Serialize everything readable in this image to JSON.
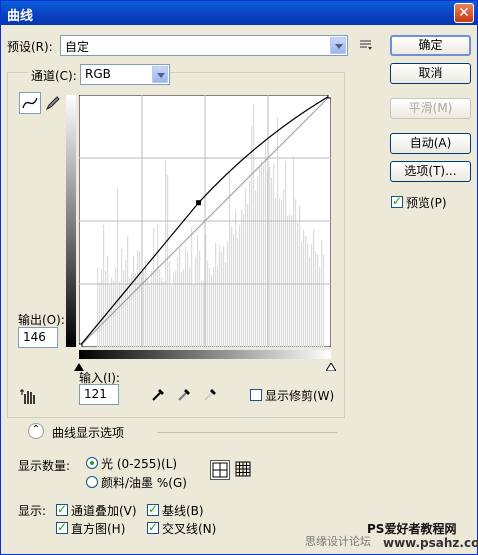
{
  "window": {
    "title": "曲线",
    "close_label": "✕"
  },
  "preset": {
    "label": "预设(R):",
    "value": "自定"
  },
  "buttons": {
    "ok": "确定",
    "cancel": "取消",
    "smooth": "平滑(M)",
    "auto": "自动(A)",
    "options": "选项(T)..."
  },
  "preview": {
    "label": "预览(P)",
    "checked": true
  },
  "channel": {
    "label": "通道(C):",
    "value": "RGB"
  },
  "output": {
    "label": "输出(O):",
    "value": "146"
  },
  "input": {
    "label": "输入(I):",
    "value": "121"
  },
  "show_clipping": {
    "label": "显示修剪(W)",
    "checked": false
  },
  "display_options": {
    "title": "曲线显示选项"
  },
  "show_amount": {
    "label": "显示数量:",
    "options": [
      {
        "label": "光 (0-255)(L)",
        "selected": true
      },
      {
        "label": "颜料/油墨 %(G)",
        "selected": false
      }
    ]
  },
  "show": {
    "label": "显示:",
    "items": [
      {
        "label": "通道叠加(V)",
        "checked": true
      },
      {
        "label": "基线(B)",
        "checked": true
      },
      {
        "label": "直方图(H)",
        "checked": true
      },
      {
        "label": "交叉线(N)",
        "checked": true
      }
    ]
  },
  "watermark": {
    "line1": "思缘设计论坛",
    "line2": "PS爱好者教程网",
    "line3": "www.psahz.com"
  },
  "curve": {
    "point": {
      "input": 121,
      "output": 146
    }
  }
}
